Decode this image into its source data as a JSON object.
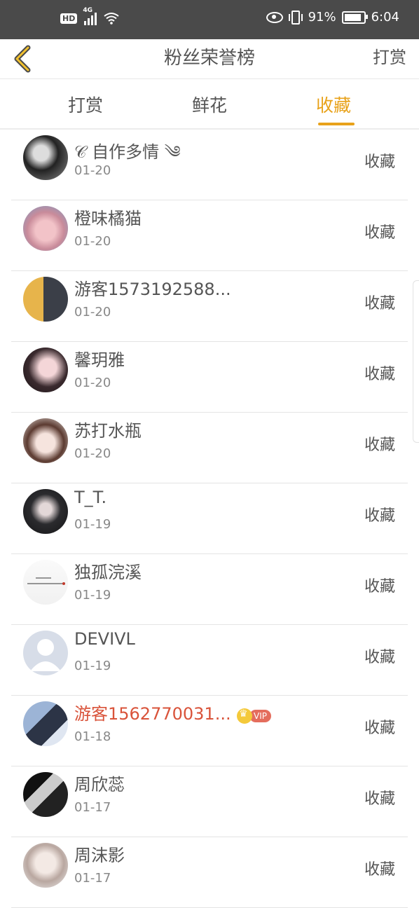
{
  "status_bar": {
    "hd": "HD",
    "network": "4G",
    "battery": "91%",
    "time": "6:04",
    "battery_level": 0.91
  },
  "nav": {
    "title": "粉丝荣誉榜",
    "right": "打赏"
  },
  "tabs": [
    {
      "label": "打赏",
      "active": false
    },
    {
      "label": "鲜花",
      "active": false
    },
    {
      "label": "收藏",
      "active": true
    }
  ],
  "colors": {
    "accent": "#e8a21a",
    "vip_name": "#d9533a",
    "vip_badge": "#e46d5d"
  },
  "list": [
    {
      "name": "𝒞 自作多情 ༄",
      "date": "01-20",
      "action": "收藏",
      "avatar": "avatar-photo-bw"
    },
    {
      "name": "橙味橘猫",
      "date": "01-20",
      "action": "收藏",
      "avatar": "avatar-photo-pink"
    },
    {
      "name": "游客1573192588...",
      "date": "01-20",
      "action": "收藏",
      "avatar": "avatar-photo-warm"
    },
    {
      "name": "馨玥雅",
      "date": "01-20",
      "action": "收藏",
      "avatar": "avatar-photo-girl"
    },
    {
      "name": "苏打水瓶",
      "date": "01-20",
      "action": "收藏",
      "avatar": "avatar-photo-girl2"
    },
    {
      "name": "T_T.",
      "date": "01-19",
      "action": "收藏",
      "avatar": "avatar-photo-dark"
    },
    {
      "name": "独孤浣溪",
      "date": "01-19",
      "action": "收藏",
      "avatar": "avatar-text-image"
    },
    {
      "name": "DEVIVL",
      "date": "01-19",
      "action": "收藏",
      "avatar": "avatar-default-person"
    },
    {
      "name": "游客1562770031...",
      "date": "01-18",
      "action": "收藏",
      "avatar": "avatar-photo-couple",
      "vip": true,
      "vip_label": "VIP"
    },
    {
      "name": "周欣蕊",
      "date": "01-17",
      "action": "收藏",
      "avatar": "avatar-photo-bw2"
    },
    {
      "name": "周沫影",
      "date": "01-17",
      "action": "收藏",
      "avatar": "avatar-photo-light"
    }
  ]
}
